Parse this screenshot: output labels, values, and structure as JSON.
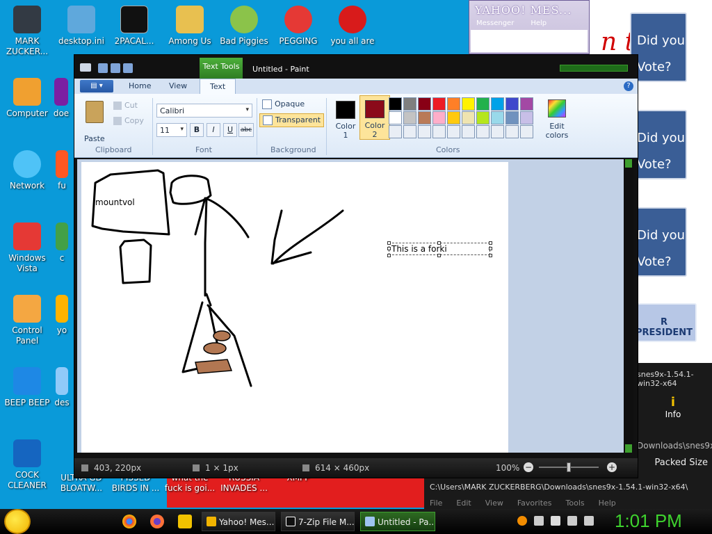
{
  "desktop": {
    "icons": [
      {
        "label": "MARK ZUCKER...",
        "color": "#333a44"
      },
      {
        "label": "desktop.ini",
        "color": "#5fa8dc"
      },
      {
        "label": "2PACAL...",
        "color": "#111111"
      },
      {
        "label": "Among Us",
        "color": "#e8c050"
      },
      {
        "label": "Bad Piggies",
        "color": "#8bc34a"
      },
      {
        "label": "PEGGING",
        "color": "#e53935"
      },
      {
        "label": "you all are",
        "color": "#d81b1b"
      },
      {
        "label": "Computer",
        "color": "#f0a030"
      },
      {
        "label": "Network",
        "color": "#4fc3f7"
      },
      {
        "label": "Windows Vista",
        "color": "#e53935"
      },
      {
        "label": "Control Panel",
        "color": "#f4a742"
      },
      {
        "label": "BEEP BEEP",
        "color": "#1e88e5"
      },
      {
        "label": "COCK CLEANER",
        "color": "#1565c0"
      },
      {
        "label": "ULTRA GD BLOATW...",
        "color": "#e21e1e"
      },
      {
        "label": "PISSED BIRDS IN ...",
        "color": "#e21e1e"
      },
      {
        "label": "what the fuck is goi...",
        "color": "#e21e1e"
      },
      {
        "label": "RUSSIA INVADES ...",
        "color": "#e21e1e"
      },
      {
        "label": "XMPP",
        "color": "#e21e1e"
      }
    ],
    "partial_labels": {
      "doe": "doe",
      "fu": "fu",
      "c": "c",
      "yo": "yo",
      "des": "des"
    }
  },
  "yahoo_window": {
    "title": "YAHOO! MES...",
    "menu": [
      "Messenger",
      "Help"
    ]
  },
  "vote_ads": {
    "cards": [
      {
        "line1": "Did you",
        "line2": "Vote?"
      },
      {
        "line1": "Did you",
        "line2": "Vote?"
      },
      {
        "line1": "Did you",
        "line2": "Vote?"
      }
    ],
    "president": "R PRESIDENT",
    "red_text": "n t"
  },
  "zip_window": {
    "title_path_short": "snes9x-1.54.1-win32-x64",
    "info_label": "Info",
    "path": "Downloads\\snes9x-",
    "packed_size_label": "Packed Size",
    "path_full": "C:\\Users\\MARK ZUCKERBERG\\Downloads\\snes9x-1.54.1-win32-x64\\",
    "menu": [
      "File",
      "Edit",
      "View",
      "Favorites",
      "Tools",
      "Help"
    ]
  },
  "paint": {
    "window_title": "Untitled - Paint",
    "context_tab": "Text Tools",
    "tabs": {
      "home": "Home",
      "view": "View",
      "text": "Text"
    },
    "clipboard": {
      "paste": "Paste",
      "cut": "Cut",
      "copy": "Copy",
      "group": "Clipboard"
    },
    "font": {
      "family": "Calibri",
      "size": "11",
      "bold": "B",
      "italic": "I",
      "underline": "U",
      "strike": "abc",
      "group": "Font"
    },
    "background": {
      "opaque": "Opaque",
      "transparent": "Transparent",
      "group": "Background"
    },
    "colors": {
      "color1_line1": "Color",
      "color1_line2": "1",
      "color1_value": "#000000",
      "color2_line1": "Color",
      "color2_line2": "2",
      "color2_value": "#8b0a1a",
      "edit_line1": "Edit",
      "edit_line2": "colors",
      "group": "Colors",
      "palette": [
        "#000000",
        "#7f7f7f",
        "#880015",
        "#ed1c24",
        "#ff7f27",
        "#fff200",
        "#22b14c",
        "#00a2e8",
        "#3f48cc",
        "#a349a4",
        "#ffffff",
        "#c3c3c3",
        "#b97a57",
        "#ffaec9",
        "#ffc90e",
        "#efe4b0",
        "#b5e61d",
        "#99d9ea",
        "#7092be",
        "#c8bfe7",
        "#e9eef5",
        "#e9eef5",
        "#e9eef5",
        "#e9eef5",
        "#e9eef5",
        "#e9eef5",
        "#e9eef5",
        "#e9eef5",
        "#e9eef5",
        "#e9eef5"
      ]
    },
    "canvas": {
      "label_text": "mountvol",
      "textbox_text": "This is a forki"
    },
    "status": {
      "cursor": "403, 220px",
      "selection": "1 × 1px",
      "size": "614 × 460px",
      "zoom": "100%",
      "minus": "−",
      "plus": "+"
    }
  },
  "taskbar": {
    "buttons": [
      {
        "label": "Yahoo! Mes...",
        "color": "#f2b400"
      },
      {
        "label": "7-Zip File M...",
        "color": "#111111"
      },
      {
        "label": "Untitled - Pa...",
        "color": "#9ec4f0"
      }
    ],
    "clock": "1:01 PM"
  }
}
